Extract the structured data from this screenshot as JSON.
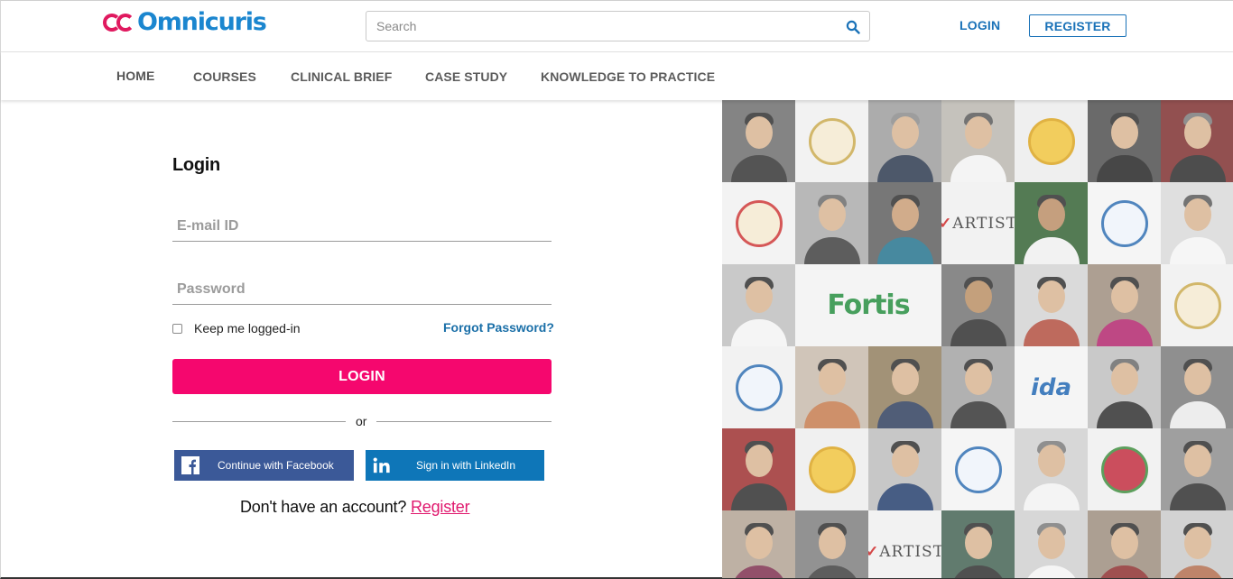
{
  "header": {
    "logo_text": "Omnicuris",
    "search_placeholder": "Search",
    "login_label": "LOGIN",
    "register_label": "REGISTER"
  },
  "nav": {
    "items": [
      {
        "label": "HOME"
      },
      {
        "label": "COURSES"
      },
      {
        "label": "CLINICAL BRIEF"
      },
      {
        "label": "CASE STUDY"
      },
      {
        "label": "KNOWLEDGE TO PRACTICE"
      }
    ]
  },
  "login": {
    "title": "Login",
    "email_placeholder": "E-mail ID",
    "password_placeholder": "Password",
    "keep_logged_in_label": "Keep me logged-in",
    "forgot_password_label": "Forgot Password?",
    "login_button_label": "LOGIN",
    "or_label": "or",
    "facebook_label": "Continue with Facebook",
    "linkedin_label": "Sign in with LinkedIn",
    "no_account_text": "Don't have an account?",
    "register_link_label": "Register"
  },
  "mosaic": {
    "artist_text": "ARTIST",
    "fortis_text": "Fortis",
    "ida_text": "ida"
  },
  "colors": {
    "brand_blue": "#1a72b8",
    "brand_pink": "#f5076e",
    "facebook_blue": "#3b5998",
    "linkedin_blue": "#0e76b8"
  }
}
